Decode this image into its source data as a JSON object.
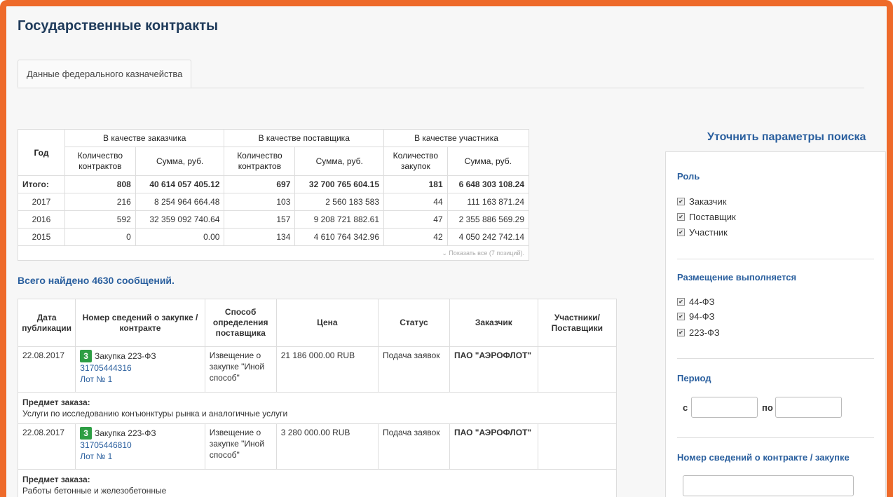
{
  "page": {
    "title": "Государственные контракты",
    "tab": "Данные федерального казначейства"
  },
  "summary": {
    "col_year": "Год",
    "groups": [
      "В качестве заказчика",
      "В качестве поставщика",
      "В качестве участника"
    ],
    "subcols": [
      "Количество контрактов",
      "Сумма, руб.",
      "Количество контрактов",
      "Сумма, руб.",
      "Количество закупок",
      "Сумма, руб."
    ],
    "rows": [
      {
        "year": "Итого:",
        "c1": "808",
        "s1": "40 614 057 405.12",
        "c2": "697",
        "s2": "32 700 765 604.15",
        "c3": "181",
        "s3": "6 648 303 108.24"
      },
      {
        "year": "2017",
        "c1": "216",
        "s1": "8 254 964 664.48",
        "c2": "103",
        "s2": "2 560 183 583",
        "c3": "44",
        "s3": "111 163 871.24"
      },
      {
        "year": "2016",
        "c1": "592",
        "s1": "32 359 092 740.64",
        "c2": "157",
        "s2": "9 208 721 882.61",
        "c3": "47",
        "s3": "2 355 886 569.29"
      },
      {
        "year": "2015",
        "c1": "0",
        "s1": "0.00",
        "c2": "134",
        "s2": "4 610 764 342.96",
        "c3": "42",
        "s3": "4 050 242 742.14"
      }
    ],
    "show_all": "⌄ Показать все (7 позиций)."
  },
  "found": "Всего найдено 4630 сообщений.",
  "list": {
    "headers": [
      "Дата публикации",
      "Номер сведений о закупке / контракте",
      "Способ определения поставщика",
      "Цена",
      "Статус",
      "Заказчик",
      "Участники/ Поставщики"
    ],
    "subject_label": "Предмет заказа:",
    "records": [
      {
        "date": "22.08.2017",
        "badge": "3",
        "type": "Закупка 223-ФЗ",
        "number": "31705444316",
        "lot": "Лот № 1",
        "method": "Извещение о закупке \"Иной способ\"",
        "price": "21 186 000.00 RUB",
        "status": "Подача заявок",
        "customer": "ПАО \"АЭРОФЛОТ\"",
        "participants": "",
        "subject": "Услуги по исследованию конъюнктуры рынка и аналогичные услуги"
      },
      {
        "date": "22.08.2017",
        "badge": "3",
        "type": "Закупка 223-ФЗ",
        "number": "31705446810",
        "lot": "Лот № 1",
        "method": "Извещение о закупке \"Иной способ\"",
        "price": "3 280 000.00 RUB",
        "status": "Подача заявок",
        "customer": "ПАО \"АЭРОФЛОТ\"",
        "participants": "",
        "subject": "Работы бетонные и железобетонные"
      }
    ]
  },
  "sidebar": {
    "title": "Уточнить параметры поиска",
    "role": {
      "title": "Роль",
      "options": [
        "Заказчик",
        "Поставщик",
        "Участник"
      ]
    },
    "placement": {
      "title": "Размещение выполняется",
      "options": [
        "44-ФЗ",
        "94-ФЗ",
        "223-ФЗ"
      ]
    },
    "period": {
      "title": "Период",
      "from": "с",
      "to": "по"
    },
    "number": {
      "title": "Номер сведений о контракте / закупке"
    },
    "checkmark": "✔"
  }
}
